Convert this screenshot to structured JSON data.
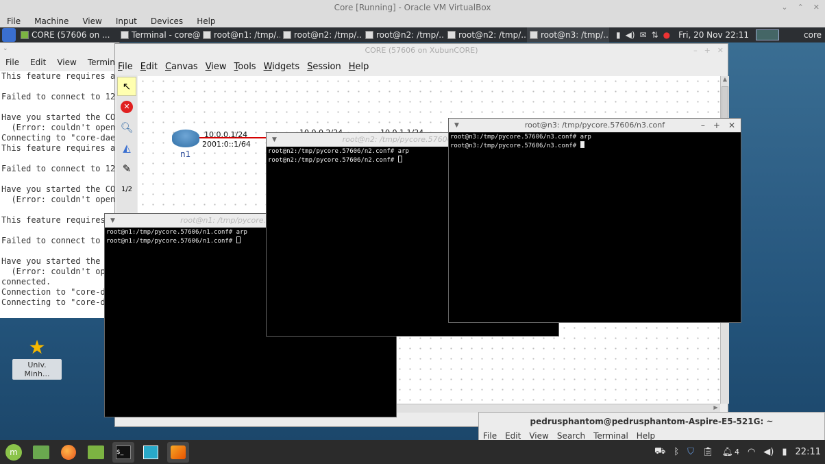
{
  "vbox": {
    "title": "Core [Running] - Oracle VM VirtualBox",
    "menu": [
      "File",
      "Machine",
      "View",
      "Input",
      "Devices",
      "Help"
    ]
  },
  "guest_panel": {
    "tasks": [
      {
        "label": "CORE (57606 on ..."
      },
      {
        "label": "Terminal - core@..."
      },
      {
        "label": "root@n1: /tmp/..."
      },
      {
        "label": "root@n2: /tmp/..."
      },
      {
        "label": "root@n2: /tmp/..."
      },
      {
        "label": "root@n2: /tmp/..."
      },
      {
        "label": "root@n3: /tmp/..."
      }
    ],
    "clock": "Fri, 20 Nov  22:11",
    "user": "core"
  },
  "log_terminal": {
    "menu": [
      "File",
      "Edit",
      "View",
      "Terminal"
    ],
    "lines": "This feature requires a\n\nFailed to connect to 127\n\nHave you started the COR\n  (Error: couldn't open\nConnecting to \"core-daem\nThis feature requires a\n\nFailed to connect to 127\n\nHave you started the COR\n  (Error: couldn't open\n\nThis feature requires\n\nFailed to connect to\n\nHave you started the c\n  (Error: couldn't ope\nconnected.\nConnection to \"core-da\nConnecting to \"core-da"
  },
  "core": {
    "title": "CORE (57606 on XubunCORE)",
    "menu": [
      "File",
      "Edit",
      "Canvas",
      "View",
      "Tools",
      "Widgets",
      "Session",
      "Help"
    ],
    "node_n1": {
      "name": "n1",
      "ipv4": "10.0.0.1/24",
      "ipv6": "2001:0::1/64"
    },
    "node_n2_partial": {
      "ipv4": "10.0.0.2/24"
    },
    "node_n3_partial": {
      "ipv4": "10.0.1.1/24"
    }
  },
  "term_n1": {
    "title": "root@n1: /tmp/pycore.57606/n1.conf",
    "lines": "root@n1:/tmp/pycore.57606/n1.conf# arp\nroot@n1:/tmp/pycore.57606/n1.conf# "
  },
  "term_n2": {
    "title": "root@n2: /tmp/pycore.57606/n2.conf",
    "lines": "root@n2:/tmp/pycore.57606/n2.conf# arp\nroot@n2:/tmp/pycore.57606/n2.conf# "
  },
  "term_n3": {
    "title": "root@n3: /tmp/pycore.57606/n3.conf",
    "lines": "root@n3:/tmp/pycore.57606/n3.conf# arp\nroot@n3:/tmp/pycore.57606/n3.conf# "
  },
  "desktop_icon": {
    "label": "Univ. Minh..."
  },
  "host_terminal": {
    "title": "pedrusphantom@pedrusphantom-Aspire-E5-521G: ~",
    "menu": [
      "File",
      "Edit",
      "View",
      "Search",
      "Terminal",
      "Help"
    ]
  },
  "taskbar": {
    "clock": "22:11",
    "notif_count": "4"
  },
  "colors": {
    "link": "#d40000",
    "router": "#3f7fb5",
    "accent": "#ffffb0"
  }
}
